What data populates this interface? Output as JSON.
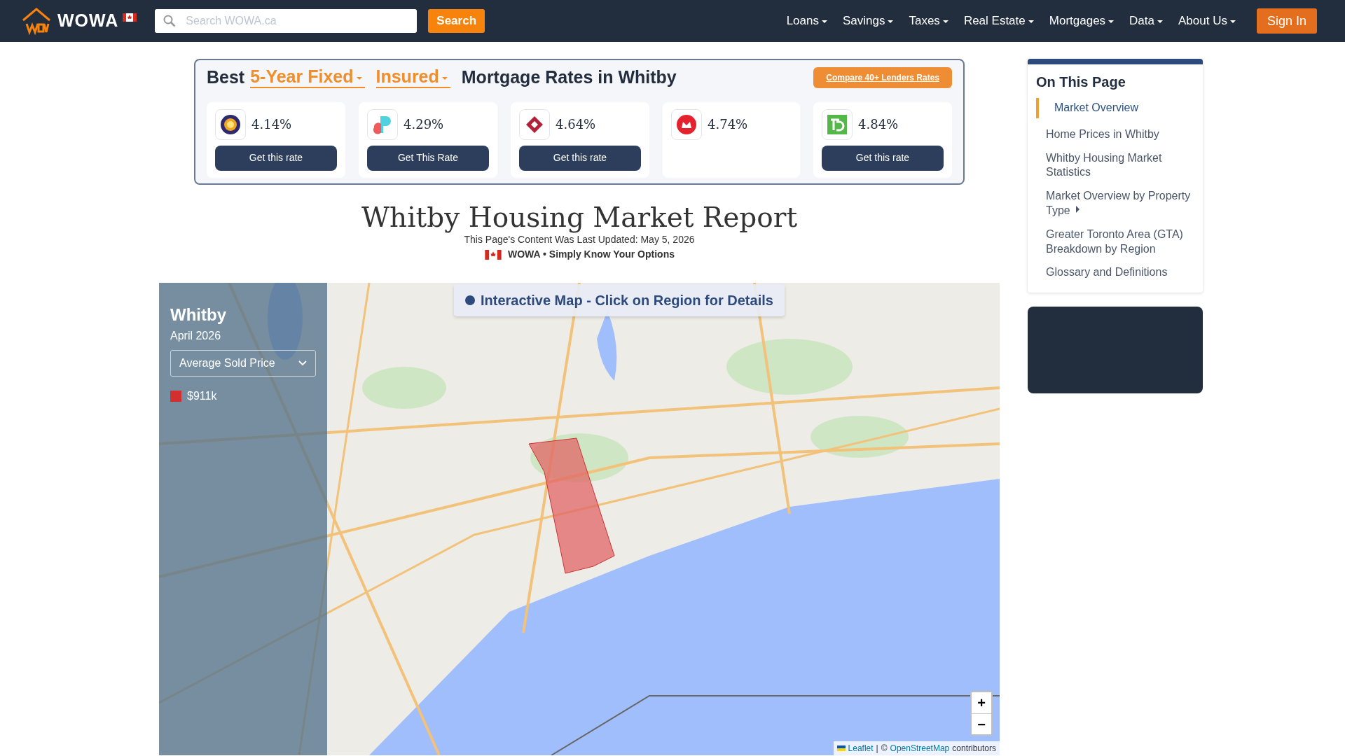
{
  "navbar": {
    "brand": "WOWA",
    "search": {
      "placeholder": "Search WOWA.ca",
      "button": "Search"
    },
    "menus": [
      "Loans",
      "Savings",
      "Taxes",
      "Real Estate",
      "Mortgages",
      "Data",
      "About Us"
    ],
    "sign_in": "Sign In"
  },
  "rates": {
    "prefix": "Best",
    "term": "5-Year Fixed",
    "insurance": "Insured",
    "suffix": "Mortgage Rates in Whitby",
    "compare": "Compare 40+ Lenders Rates",
    "lenders": [
      {
        "rate": "4.14%",
        "button": "Get this rate"
      },
      {
        "rate": "4.29%",
        "button": "Get This Rate"
      },
      {
        "rate": "4.64%",
        "button": "Get this rate"
      },
      {
        "rate": "4.74%"
      },
      {
        "rate": "4.84%",
        "button": "Get this rate"
      }
    ]
  },
  "report": {
    "title": "Whitby Housing Market Report",
    "updated": "This Page's Content Was Last Updated: May 5, 2026",
    "tagline": "WOWA • Simply Know Your Options"
  },
  "map": {
    "banner": "Interactive Map - Click on Region for Details",
    "region": "Whitby",
    "period": "April 2026",
    "metric": "Average Sold Price",
    "legend": [
      {
        "color": "#d32f2f",
        "label": "$911k"
      }
    ],
    "zoom_in": "+",
    "zoom_out": "−",
    "attribution": {
      "leaflet": "Leaflet",
      "separator": "|",
      "copyright": "©",
      "osm": "OpenStreetMap",
      "suffix": "contributors"
    }
  },
  "sidebar": {
    "title": "On This Page",
    "items": [
      {
        "label": "Market Overview",
        "selected": true,
        "has_submenu": false
      },
      {
        "label": "Home Prices in Whitby",
        "selected": false,
        "has_submenu": false
      },
      {
        "label": "Whitby Housing Market Statistics",
        "selected": false,
        "has_submenu": false
      },
      {
        "label": "Market Overview by Property Type",
        "selected": false,
        "has_submenu": true
      },
      {
        "label": "Greater Toronto Area (GTA) Breakdown by Region",
        "selected": false,
        "has_submenu": false
      },
      {
        "label": "Glossary and Definitions",
        "selected": false,
        "has_submenu": false
      }
    ]
  }
}
